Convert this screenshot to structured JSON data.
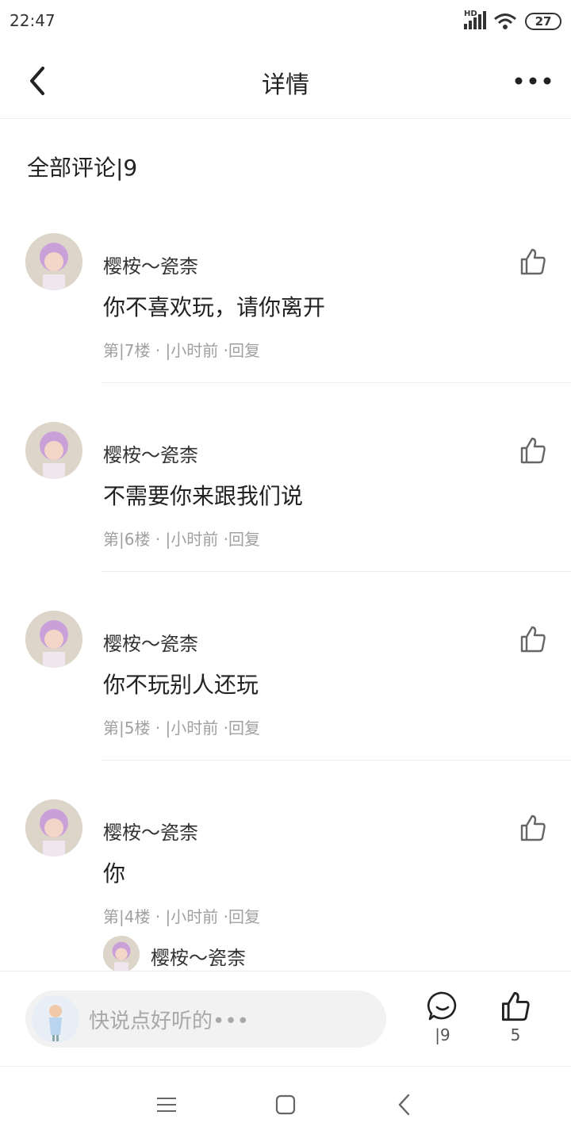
{
  "status_bar": {
    "time": "22:47",
    "network": "HD",
    "battery": "27"
  },
  "header": {
    "title": "详情"
  },
  "section": {
    "title": "全部评论|9"
  },
  "comments": [
    {
      "user": "樱桉～瓷柰",
      "text": "你不喜欢玩，请你离开",
      "meta": "第|7楼 · |小时前 ·回复"
    },
    {
      "user": "樱桉～瓷柰",
      "text": "不需要你来跟我们说",
      "meta": "第|6楼 · |小时前 ·回复"
    },
    {
      "user": "樱桉～瓷柰",
      "text": "你不玩别人还玩",
      "meta": "第|5楼 · |小时前 ·回复"
    },
    {
      "user": "樱桉～瓷柰",
      "text": "你",
      "meta": "第|4楼 · |小时前 ·回复"
    }
  ],
  "reply_preview": {
    "user": "樱桉～瓷柰"
  },
  "bottom_bar": {
    "placeholder": "快说点好听的•••",
    "comment_count": "|9",
    "like_count": "5"
  },
  "colors": {
    "accent": "#222222",
    "muted": "#a0a0a0",
    "divider": "#ececec"
  }
}
